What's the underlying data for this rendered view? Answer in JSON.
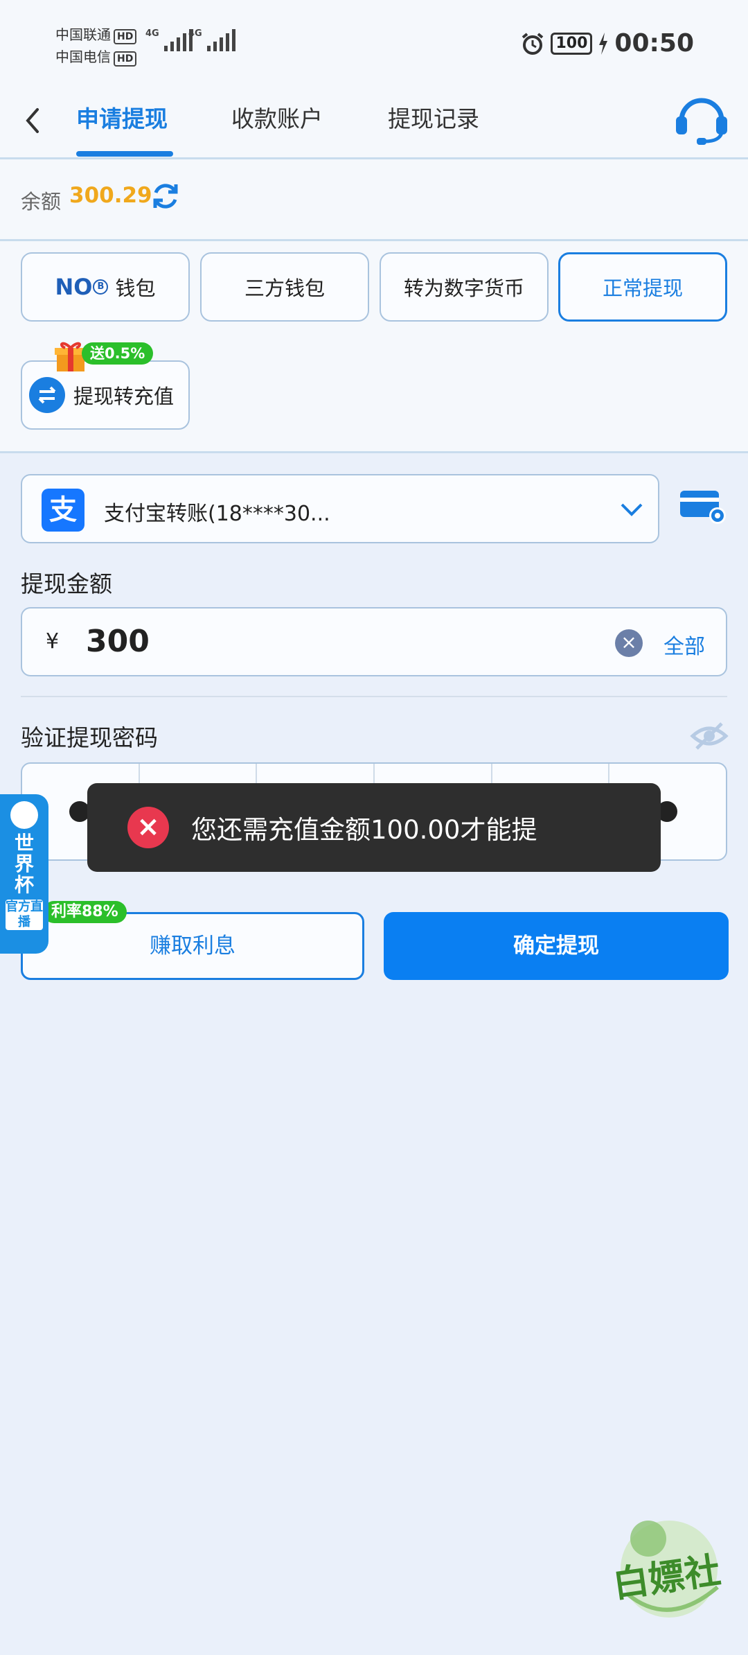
{
  "status_bar": {
    "carrier1": "中国联通",
    "carrier2": "中国电信",
    "hd": "HD",
    "network": "4G",
    "battery": "100",
    "time": "00:50"
  },
  "header": {
    "tabs": [
      {
        "label": "申请提现",
        "active": true
      },
      {
        "label": "收款账户",
        "active": false
      },
      {
        "label": "提现记录",
        "active": false
      }
    ]
  },
  "balance": {
    "label": "余额",
    "value": "300.29"
  },
  "methods": {
    "wallet_logo": "NO",
    "wallet_coin": "B",
    "wallet": "钱包",
    "third_party": "三方钱包",
    "digital": "转为数字货币",
    "normal": "正常提现",
    "recharge": "提现转充值",
    "gift_badge": "送0.5%"
  },
  "account": {
    "icon_text": "支",
    "text": "支付宝转账(18****30..."
  },
  "amount": {
    "label": "提现金额",
    "currency": "¥",
    "value": "300",
    "clear": "×",
    "all": "全部"
  },
  "password": {
    "label": "验证提现密码",
    "digits_entered": 6
  },
  "buttons": {
    "interest": "赚取利息",
    "rate_badge": "利率88%",
    "confirm": "确定提现"
  },
  "worldcup": {
    "title": "世界杯",
    "sub": "官方直播"
  },
  "toast": {
    "icon": "×",
    "message": "您还需充值金额100.00才能提"
  },
  "watermark": {
    "text": "白嫖社"
  },
  "colors": {
    "accent": "#1a7ee0",
    "balance": "#f0a81c",
    "badge": "#2bbf2a",
    "error": "#e8384f"
  }
}
